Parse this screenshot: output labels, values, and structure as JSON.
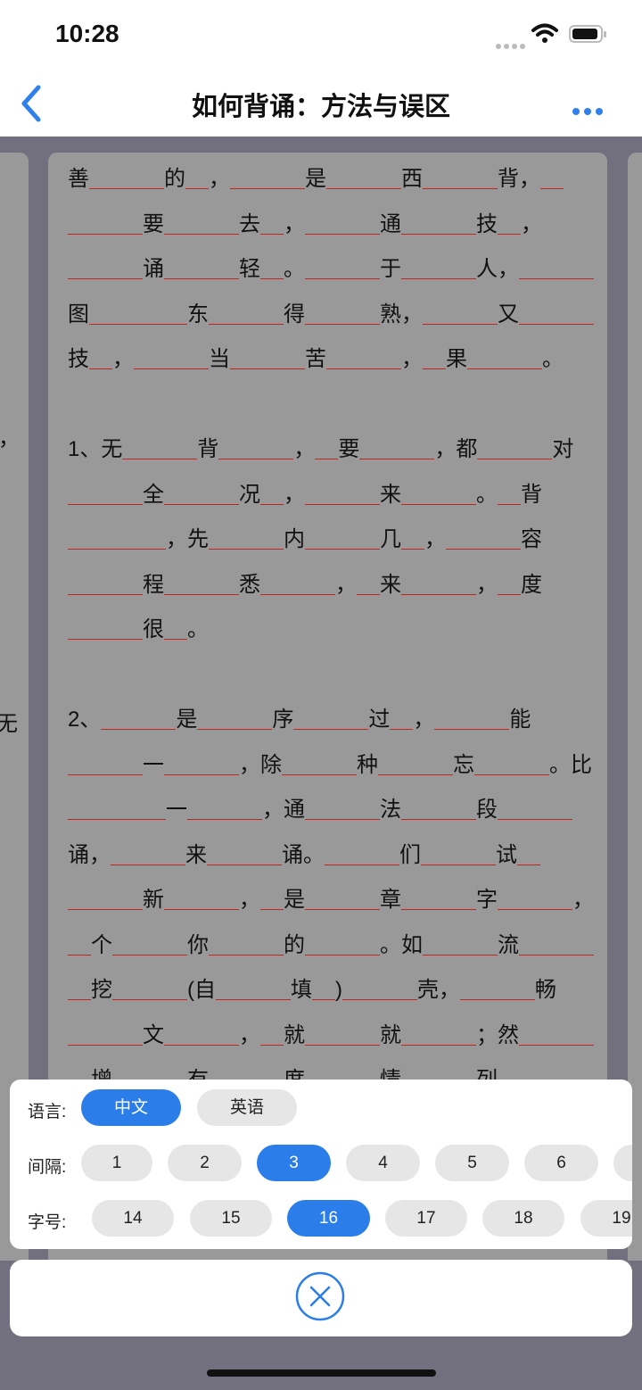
{
  "status_bar": {
    "time": "10:28"
  },
  "nav": {
    "title": "如何背诵：方法与误区"
  },
  "content": {
    "peek_left": [
      "，",
      "无"
    ],
    "paragraphs": [
      "善___的_，___是___西___背，_ ___要___去_，___通___技_，___ 诵___轻_。___于___人，___图_ ___东___得___熟，___又___技 _，___当___苦___，_果___。",
      "1、无___背___，_要___，都___对 ___全___况_，___来___。_背___ _，先___内___几_，___容___程 ___悉___，_来___，_度___很_。",
      "2、___是___序___过_，___能___ 一___，除___种___忘___。比_ ___一___，通___法___段___ 诵，___来___诵。___们___试_ ___新___，_是___章___字___，_ 个___你___的___。如___流___ _挖___(自___填_)___壳，___畅 ___文___，_就___就___；然___ _增___有___度___情___列"
    ]
  },
  "settings": {
    "language": {
      "label": "语言:",
      "options": [
        "中文",
        "英语"
      ],
      "selected": "中文"
    },
    "interval": {
      "label": "间隔:",
      "options": [
        "1",
        "2",
        "3",
        "4",
        "5",
        "6",
        ""
      ],
      "selected": "3"
    },
    "font_size": {
      "label": "字号:",
      "options": [
        "14",
        "15",
        "16",
        "17",
        "18",
        "19"
      ],
      "selected": "16"
    }
  },
  "colors": {
    "accent": "#2b7de9",
    "blank_underline": "#c0281f",
    "dim_background": "#72707f",
    "card": "#999999"
  }
}
